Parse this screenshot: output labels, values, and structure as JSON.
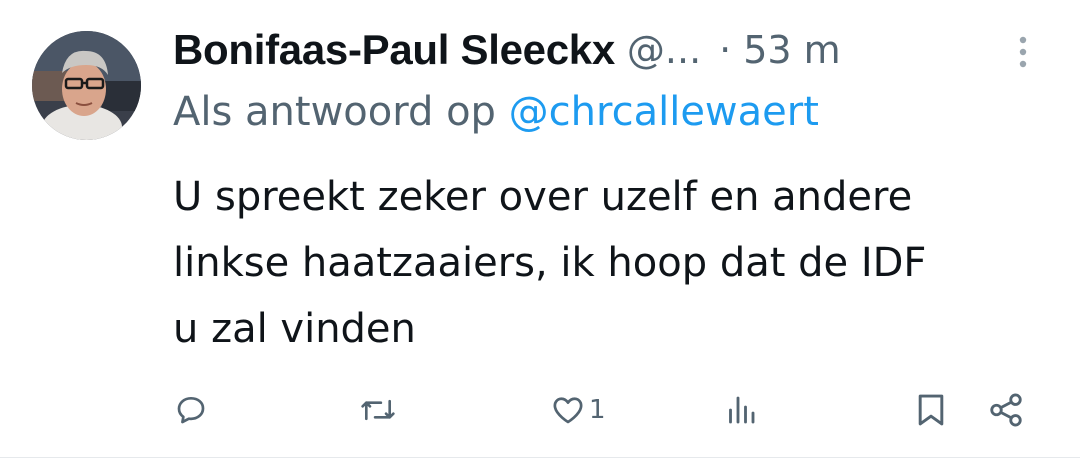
{
  "tweet": {
    "author": {
      "display_name": "Bonifaas-Paul Sleeckx",
      "handle": "@...",
      "avatar_icon": "profile-photo"
    },
    "separator": "·",
    "time": "53 m",
    "reply_prefix": "Als antwoord op",
    "reply_to": "@chrcallewaert",
    "body_lines": [
      "U spreekt zeker over uzelf en andere",
      "linkse haatzaaiers, ik hoop dat de IDF",
      "u zal vinden"
    ],
    "actions": {
      "reply": {
        "icon": "reply-icon",
        "count": ""
      },
      "retweet": {
        "icon": "retweet-icon",
        "count": ""
      },
      "like": {
        "icon": "heart-icon",
        "count": "1"
      },
      "views": {
        "icon": "views-icon",
        "count": ""
      },
      "bookmark": {
        "icon": "bookmark-icon"
      },
      "share": {
        "icon": "share-icon"
      }
    }
  },
  "colors": {
    "text": "#0f1419",
    "secondary": "#536471",
    "link": "#1d9bf0",
    "more_icon": "#9aa5ae"
  }
}
